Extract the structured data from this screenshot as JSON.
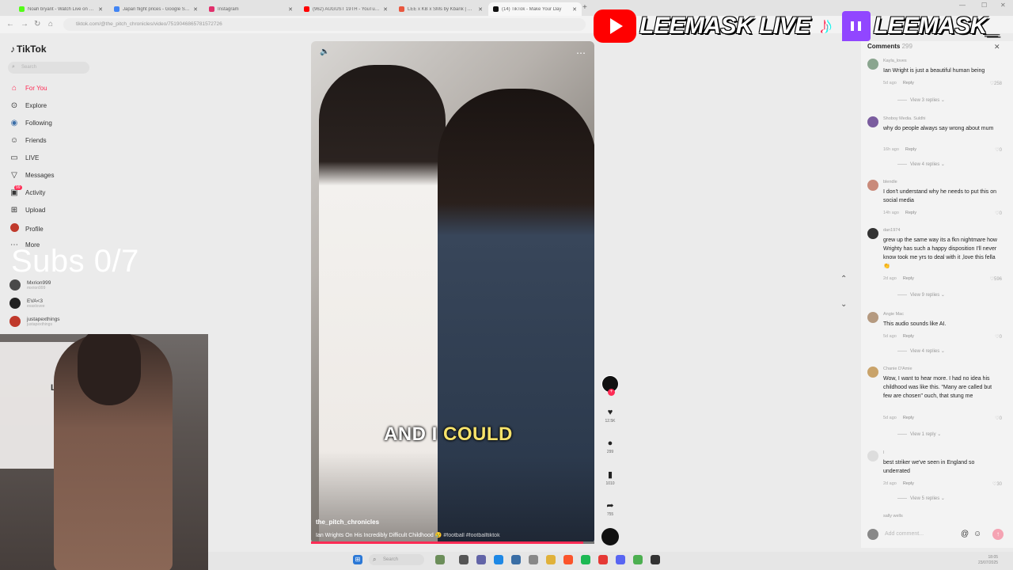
{
  "browser": {
    "tabs": [
      {
        "title": "Noah bryant - Watch Live on Kick",
        "color": "#53fc18"
      },
      {
        "title": "Japan flight prices - Google Search",
        "color": "#4285f4"
      },
      {
        "title": "Instagram",
        "color": "#e1306c"
      },
      {
        "title": "(962) AUGUST 19TH - YouTube",
        "color": "#ff0000"
      },
      {
        "title": "LEE x KB x SMs by Kbank | Spotify",
        "color": "#e9573f"
      },
      {
        "title": "(14) TikTok - Make Your Day",
        "color": "#111111"
      }
    ],
    "url": "tiktok.com/@the_pitch_chronicles/video/7519046865781572726"
  },
  "sidebar": {
    "logo": "TikTok",
    "search_placeholder": "Search",
    "items": [
      {
        "label": "For You",
        "icon": "home-icon"
      },
      {
        "label": "Explore",
        "icon": "compass-icon"
      },
      {
        "label": "Following",
        "icon": "following-icon"
      },
      {
        "label": "Friends",
        "icon": "friends-icon"
      },
      {
        "label": "LIVE",
        "icon": "live-icon"
      },
      {
        "label": "Messages",
        "icon": "messages-icon"
      },
      {
        "label": "Activity",
        "icon": "activity-icon",
        "badge": "99"
      },
      {
        "label": "Upload",
        "icon": "upload-icon"
      },
      {
        "label": "Profile",
        "icon": "profile-icon"
      },
      {
        "label": "More",
        "icon": "more-icon"
      }
    ],
    "following_accounts": [
      {
        "name": "Mxrion999",
        "handle": "mxrion999"
      },
      {
        "name": "EVA<3",
        "handle": "evaxlovee"
      },
      {
        "name": "justapexthings",
        "handle": "justapexthings"
      }
    ]
  },
  "overlay": {
    "subs": "Subs 0/7",
    "stream_name_1": "LEEMASK LIVE",
    "stream_name_2": "LEEMASK_"
  },
  "video": {
    "caption_white": "AND I ",
    "caption_yellow": "COULD",
    "author": "the_pitch_chronicles",
    "description": "Ian Wrights On His Incredibly Difficult Childhood 😢 ",
    "hashtags": "#football #footballtiktok",
    "progress": 0.96
  },
  "actions": {
    "likes": "12.5K",
    "comments": "299",
    "saves": "1010",
    "shares": "755"
  },
  "comments": {
    "title": "Comments",
    "count": "299",
    "input_placeholder": "Add comment...",
    "items": [
      {
        "user": "Kayla_loves",
        "text": "Ian Wright is just a beautiful human being",
        "time": "5d ago",
        "likes": "258",
        "replies": "View 3 replies",
        "avatar": "#8aa58f"
      },
      {
        "user": "Shoboy Media. Suldhi",
        "text": "why do people always say wrong about mum",
        "time": "16h ago",
        "likes": "0",
        "replies": "View 4 replies",
        "avatar": "#7a5c9e"
      },
      {
        "user": "blendle",
        "text": "I don't understand why he needs to put this on social media",
        "time": "14h ago",
        "likes": "0",
        "replies": "",
        "avatar": "#c98a7a"
      },
      {
        "user": "dan1974",
        "text": "grew up the same way its a fkn nightmare how Wrighty has such a happy disposition I'll never know took me yrs to deal with it ,love this fella 👏",
        "time": "2d ago",
        "likes": "596",
        "replies": "View 9 replies",
        "avatar": "#333333"
      },
      {
        "user": "Angie Mac",
        "text": "This audio sounds like AI.",
        "time": "5d ago",
        "likes": "0",
        "replies": "View 4 replies",
        "avatar": "#b59a80"
      },
      {
        "user": "Chanie D'Amie",
        "text": "Wow, I want to hear more. I had no idea his childhood was like this. \"Many are called but few are chosen\" ouch, that stung me",
        "time": "5d ago",
        "likes": "0",
        "replies": "View 1 reply",
        "avatar": "#c9a36a"
      },
      {
        "user": "l",
        "text": "best striker we've seen in England so underrated",
        "time": "2d ago",
        "likes": "30",
        "replies": "View 5 replies",
        "avatar": "#dddddd"
      },
      {
        "user": "sally wells",
        "text": "",
        "time": "",
        "likes": "",
        "replies": "",
        "avatar": "#bbbbbb"
      }
    ]
  },
  "taskbar": {
    "search_placeholder": "Search",
    "time": "18:05",
    "date": "23/07/2025"
  }
}
